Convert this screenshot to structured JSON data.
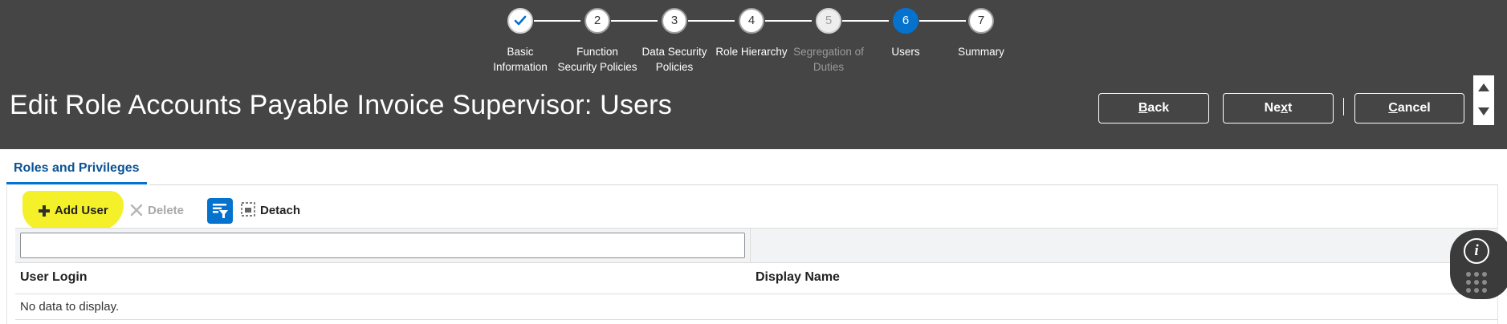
{
  "train": {
    "steps": [
      {
        "number": "",
        "label_line1": "Basic",
        "label_line2": "Information",
        "state": "done"
      },
      {
        "number": "2",
        "label_line1": "Function",
        "label_line2": "Security Policies",
        "state": "normal"
      },
      {
        "number": "3",
        "label_line1": "Data Security",
        "label_line2": "Policies",
        "state": "normal"
      },
      {
        "number": "4",
        "label_line1": "Role Hierarchy",
        "label_line2": "",
        "state": "normal"
      },
      {
        "number": "5",
        "label_line1": "Segregation of",
        "label_line2": "Duties",
        "state": "disabled"
      },
      {
        "number": "6",
        "label_line1": "Users",
        "label_line2": "",
        "state": "current"
      },
      {
        "number": "7",
        "label_line1": "Summary",
        "label_line2": "",
        "state": "normal"
      }
    ]
  },
  "header": {
    "title": "Edit Role Accounts Payable Invoice Supervisor: Users",
    "back": {
      "accesskey": "B",
      "rest": "ack"
    },
    "next": {
      "pre": "Ne",
      "accesskey": "x",
      "rest": "t"
    },
    "cancel": {
      "accesskey": "C",
      "rest": "ancel"
    }
  },
  "tabs": {
    "active": "Roles and Privileges"
  },
  "toolbar": {
    "add_user": "Add User",
    "delete": "Delete",
    "detach": "Detach"
  },
  "table": {
    "filter_value": "",
    "columns": [
      "User Login",
      "Display Name"
    ],
    "empty_message": "No data to display."
  },
  "widget": {
    "info_glyph": "i"
  },
  "colors": {
    "header_bg": "#454545",
    "accent": "#0572ce",
    "tab_text": "#0b5394",
    "highlight": "#f4f02a"
  },
  "icons": [
    "check-icon",
    "scroll-up-icon",
    "scroll-down-icon",
    "plus-icon",
    "delete-x-icon",
    "query-filter-icon",
    "detach-icon",
    "info-icon",
    "apps-grid-icon"
  ]
}
